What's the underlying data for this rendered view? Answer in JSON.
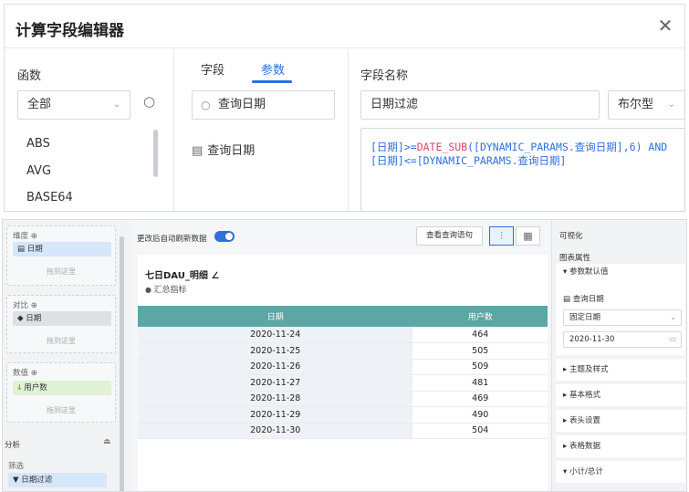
{
  "dialog": {
    "title": "计算字段编辑器",
    "close_icon": "close-icon",
    "functions": {
      "label": "函数",
      "category": "全部",
      "items": [
        "ABS",
        "AVG",
        "BASE64"
      ]
    },
    "params": {
      "tabs": [
        "字段",
        "参数"
      ],
      "active_tab": "参数",
      "search_value": "查询日期",
      "items": [
        "查询日期"
      ]
    },
    "field": {
      "label": "字段名称",
      "name_value": "日期过滤",
      "type_value": "布尔型",
      "formula_line1_a": "[日期]>=",
      "formula_line1_fn": "DATE_SUB",
      "formula_line1_b": "([DYNAMIC_PARAMS.查询日期],6) AND",
      "formula_line2": "[日期]<=[DYNAMIC_PARAMS.查询日期]"
    }
  },
  "dashboard": {
    "left": {
      "dimension_label": "维度 ⊕",
      "dimension_item": "日期",
      "compare_label": "对比 ⊕",
      "compare_item": "日期",
      "value_label": "数值 ⊕",
      "value_item": "用户数",
      "drop_hint": "拖到这里",
      "analysis_label": "分析",
      "filter_label": "筛选",
      "filter_item": "日期过滤"
    },
    "toolbar": {
      "auto_refresh_label": "更改后自动刷新数据",
      "auto_refresh_on": true,
      "query_button": "查看查询语句"
    },
    "card": {
      "title": "七日DAU_明细 ∠",
      "subtitle": "汇总指标",
      "columns": [
        "日期",
        "用户数"
      ],
      "rows": [
        [
          "2020-11-24",
          "464"
        ],
        [
          "2020-11-25",
          "505"
        ],
        [
          "2020-11-26",
          "509"
        ],
        [
          "2020-11-27",
          "481"
        ],
        [
          "2020-11-28",
          "469"
        ],
        [
          "2020-11-29",
          "490"
        ],
        [
          "2020-11-30",
          "504"
        ]
      ]
    },
    "right": {
      "title": "可视化",
      "chart_props": "图表属性",
      "param_default": "▾ 参数默认值",
      "param_name": "查询日期",
      "param_mode": "固定日期",
      "param_date": "2020-11-30",
      "sections": [
        "▸ 主题及样式",
        "▸ 基本格式",
        "▸ 表头设置",
        "▸ 表格数据",
        "▾ 小计/总计"
      ]
    }
  }
}
